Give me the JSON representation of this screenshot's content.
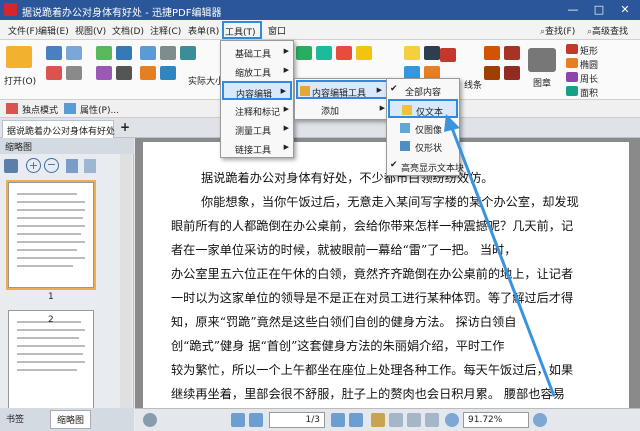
{
  "app": {
    "title": "据说跪着办公对身体有好处 - 迅捷PDF编辑器",
    "minimize": "—",
    "maximize": "□",
    "close": "✕"
  },
  "menubar": {
    "items": [
      "文件(F)",
      "编辑(E)",
      "视图(V)",
      "文档(D)",
      "注释(C)",
      "表单(R)",
      "工具(T)",
      "窗口"
    ],
    "find_label": "查找(F)",
    "adv_find_label": "高级查找"
  },
  "ribbon": {
    "open_label": "打开(O)",
    "actual_size_label": "实际大小",
    "line_label": "线条",
    "stamp_label": "图章",
    "shape_label": "矩形",
    "ellipse_label": "椭圆",
    "perimeter_label": "周长",
    "area_label": "面积"
  },
  "toolbar2": {
    "select_mode": "独点模式",
    "properties": "属性(P)..."
  },
  "tab": {
    "title": "据说跪着办公对身体有好处",
    "add": "+"
  },
  "tools_menu": {
    "items": [
      "基础工具",
      "缩放工具",
      "内容编辑",
      "注释和标记",
      "测量工具",
      "链接工具"
    ]
  },
  "content_submenu": {
    "items": [
      "内容编辑工具",
      "添加"
    ]
  },
  "edit_submenu": {
    "items": [
      "全部内容",
      "仅文本",
      "仅图像",
      "仅形状",
      "高亮显示文本块"
    ]
  },
  "left_panel": {
    "header": "缩略图",
    "page1": "1",
    "page2": "2",
    "tab_bookmarks": "书签",
    "tab_thumbs": "缩略图"
  },
  "document": {
    "lines": [
      "据说跪着办公对身体有好处，不少都市白领纷纷效仿。",
      "你能想象，当你午饭过后，无意走入某间写字楼的某个办公室，却发现",
      "眼前所有的人都跪倒在办公桌前，会给你带来怎样一种震撼呢？几天前，记",
      "者在一家单位采访的时候，就被眼前一幕给“雷”了一把。            当时，",
      "办公室里五六位正在午休的白领，竟然齐齐跪倒在办公桌前的地上，让记者",
      "一时以为这家单位的领导是不是正在对员工进行某种体罚。等了解过后才得",
      "知，原来“罚跪”竟然是这些白领们自创的健身方法。         探访白领自",
      "创“跪式”健身          据“首创”这套健身方法的朱丽娟介绍，平时工作",
      "较为繁忙，所以一个上午都坐在座位上处理各种工作。每天午饭过后，如果",
      "继续再坐着，里部会很不舒服，肚子上的赘肉也会日积月累。  腰部也容易"
    ]
  },
  "status": {
    "page": "1/3",
    "zoom": "91.72%"
  }
}
